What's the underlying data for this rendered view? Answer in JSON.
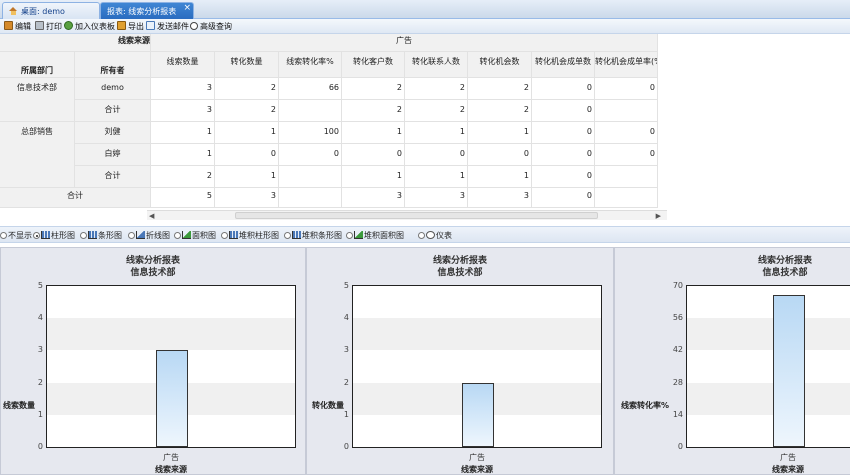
{
  "tabs": [
    {
      "label": "桌面: demo",
      "active": false
    },
    {
      "label": "报表: 线索分析报表",
      "active": true
    }
  ],
  "toolbar": [
    "编辑",
    "打印",
    "加入仪表板",
    "导出",
    "发送邮件",
    "高级查询"
  ],
  "report": {
    "corner_label": "线索来源",
    "group_label": "广告",
    "col_dept": "所属部门",
    "col_owner": "所有者",
    "columns": [
      "线索数量",
      "转化数量",
      "线索转化率%",
      "转化客户数",
      "转化联系人数",
      "转化机会数",
      "转化机会成单数",
      "转化机会成单率(%"
    ],
    "rows": [
      {
        "dept": "信息技术部",
        "owner": "demo",
        "values": [
          "3",
          "2",
          "66",
          "2",
          "2",
          "2",
          "0",
          "0"
        ]
      },
      {
        "dept": "",
        "owner": "合计",
        "values": [
          "3",
          "2",
          "",
          "2",
          "2",
          "2",
          "0",
          ""
        ]
      },
      {
        "dept": "总部销售",
        "owner": "刘健",
        "values": [
          "1",
          "1",
          "100",
          "1",
          "1",
          "1",
          "0",
          "0"
        ]
      },
      {
        "dept": "",
        "owner": "白婷",
        "values": [
          "1",
          "0",
          "0",
          "0",
          "0",
          "0",
          "0",
          "0"
        ]
      },
      {
        "dept": "",
        "owner": "合计",
        "values": [
          "2",
          "1",
          "",
          "1",
          "1",
          "1",
          "0",
          ""
        ]
      }
    ],
    "total": {
      "label": "合计",
      "values": [
        "5",
        "3",
        "",
        "3",
        "3",
        "3",
        "0",
        ""
      ]
    }
  },
  "chart_types": [
    {
      "label": "不显示",
      "selected": false,
      "icon": "none"
    },
    {
      "label": "柱形图",
      "selected": true,
      "icon": "column-chart-icon"
    },
    {
      "label": "条形图",
      "selected": false,
      "icon": "bar-chart-icon"
    },
    {
      "label": "折线图",
      "selected": false,
      "icon": "line-chart-icon"
    },
    {
      "label": "面积图",
      "selected": false,
      "icon": "area-chart-icon"
    },
    {
      "label": "堆积柱形图",
      "selected": false,
      "icon": "stacked-column-icon"
    },
    {
      "label": "堆积条形图",
      "selected": false,
      "icon": "stacked-bar-icon"
    },
    {
      "label": "堆积面积图",
      "selected": false,
      "icon": "stacked-area-icon"
    },
    {
      "label": "仪表",
      "selected": false,
      "icon": "gauge-icon"
    }
  ],
  "chart_data": [
    {
      "type": "bar",
      "title": "线索分析报表",
      "subtitle": "信息技术部",
      "xlabel": "线索来源",
      "ylabel": "线索数量",
      "categories": [
        "广告"
      ],
      "values": [
        3
      ],
      "ylim": [
        0,
        5
      ],
      "yticks": [
        "0",
        "1",
        "2",
        "3",
        "4",
        "5"
      ],
      "grid": true
    },
    {
      "type": "bar",
      "title": "线索分析报表",
      "subtitle": "信息技术部",
      "xlabel": "线索来源",
      "ylabel": "转化数量",
      "categories": [
        "广告"
      ],
      "values": [
        2
      ],
      "ylim": [
        0,
        5
      ],
      "yticks": [
        "0",
        "1",
        "2",
        "3",
        "4",
        "5"
      ],
      "grid": true
    },
    {
      "type": "bar",
      "title": "线索分析报表",
      "subtitle": "信息技术部",
      "xlabel": "线索来源",
      "ylabel": "线索转化率%",
      "categories": [
        "广告"
      ],
      "values": [
        66
      ],
      "ylim": [
        0,
        70
      ],
      "yticks": [
        "0",
        "14",
        "28",
        "42",
        "56",
        "70"
      ],
      "grid": true
    }
  ]
}
